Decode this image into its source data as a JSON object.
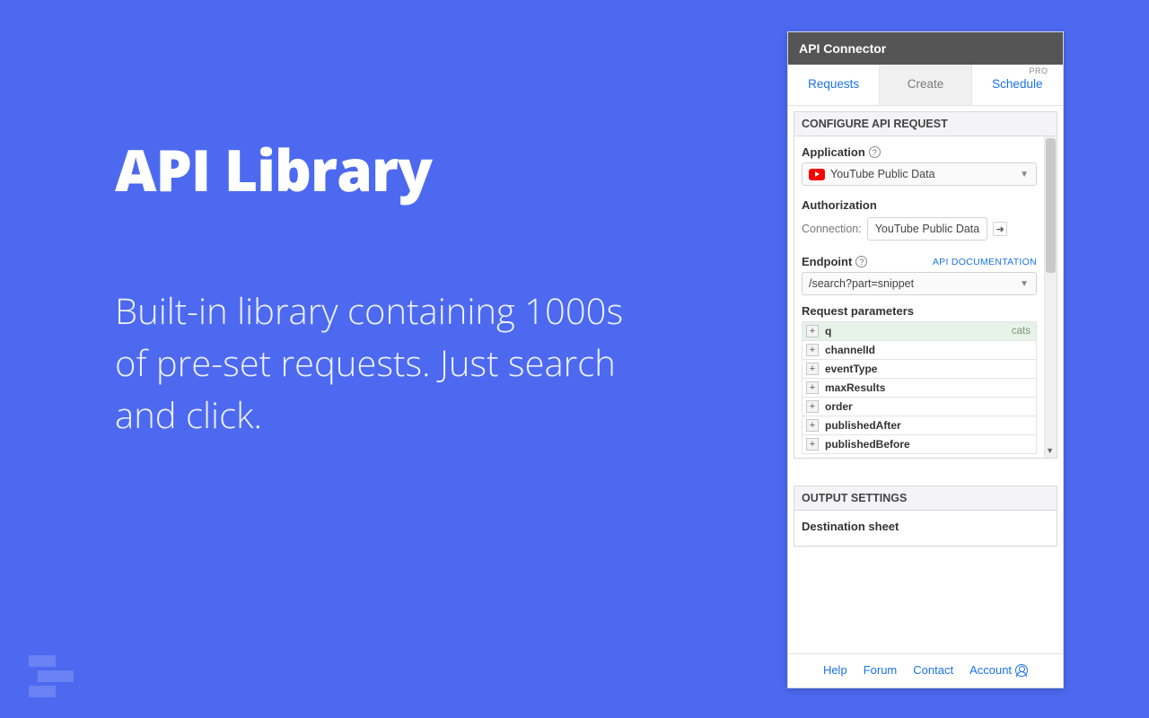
{
  "hero": {
    "title": "API Library",
    "description": "Built-in library containing 1000s of pre-set requests. Just search and click."
  },
  "panel": {
    "title": "API Connector",
    "tabs": [
      {
        "label": "Requests",
        "active": false,
        "pro": false
      },
      {
        "label": "Create",
        "active": true,
        "pro": false
      },
      {
        "label": "Schedule",
        "active": false,
        "pro": true
      }
    ],
    "pro_tag": "PRO",
    "configure_header": "CONFIGURE API REQUEST",
    "application": {
      "label": "Application",
      "value": "YouTube Public Data"
    },
    "authorization": {
      "label": "Authorization",
      "connection_label": "Connection:",
      "value": "YouTube Public Data"
    },
    "endpoint": {
      "label": "Endpoint",
      "doc_link": "API DOCUMENTATION",
      "value": "/search?part=snippet"
    },
    "params_label": "Request parameters",
    "params": [
      {
        "name": "q",
        "value": "cats",
        "filled": true
      },
      {
        "name": "channelId",
        "value": "",
        "filled": false
      },
      {
        "name": "eventType",
        "value": "",
        "filled": false
      },
      {
        "name": "maxResults",
        "value": "",
        "filled": false
      },
      {
        "name": "order",
        "value": "",
        "filled": false
      },
      {
        "name": "publishedAfter",
        "value": "",
        "filled": false
      },
      {
        "name": "publishedBefore",
        "value": "",
        "filled": false
      }
    ],
    "output_header": "OUTPUT SETTINGS",
    "destination_label": "Destination sheet",
    "footer": {
      "help": "Help",
      "forum": "Forum",
      "contact": "Contact",
      "account": "Account"
    }
  }
}
